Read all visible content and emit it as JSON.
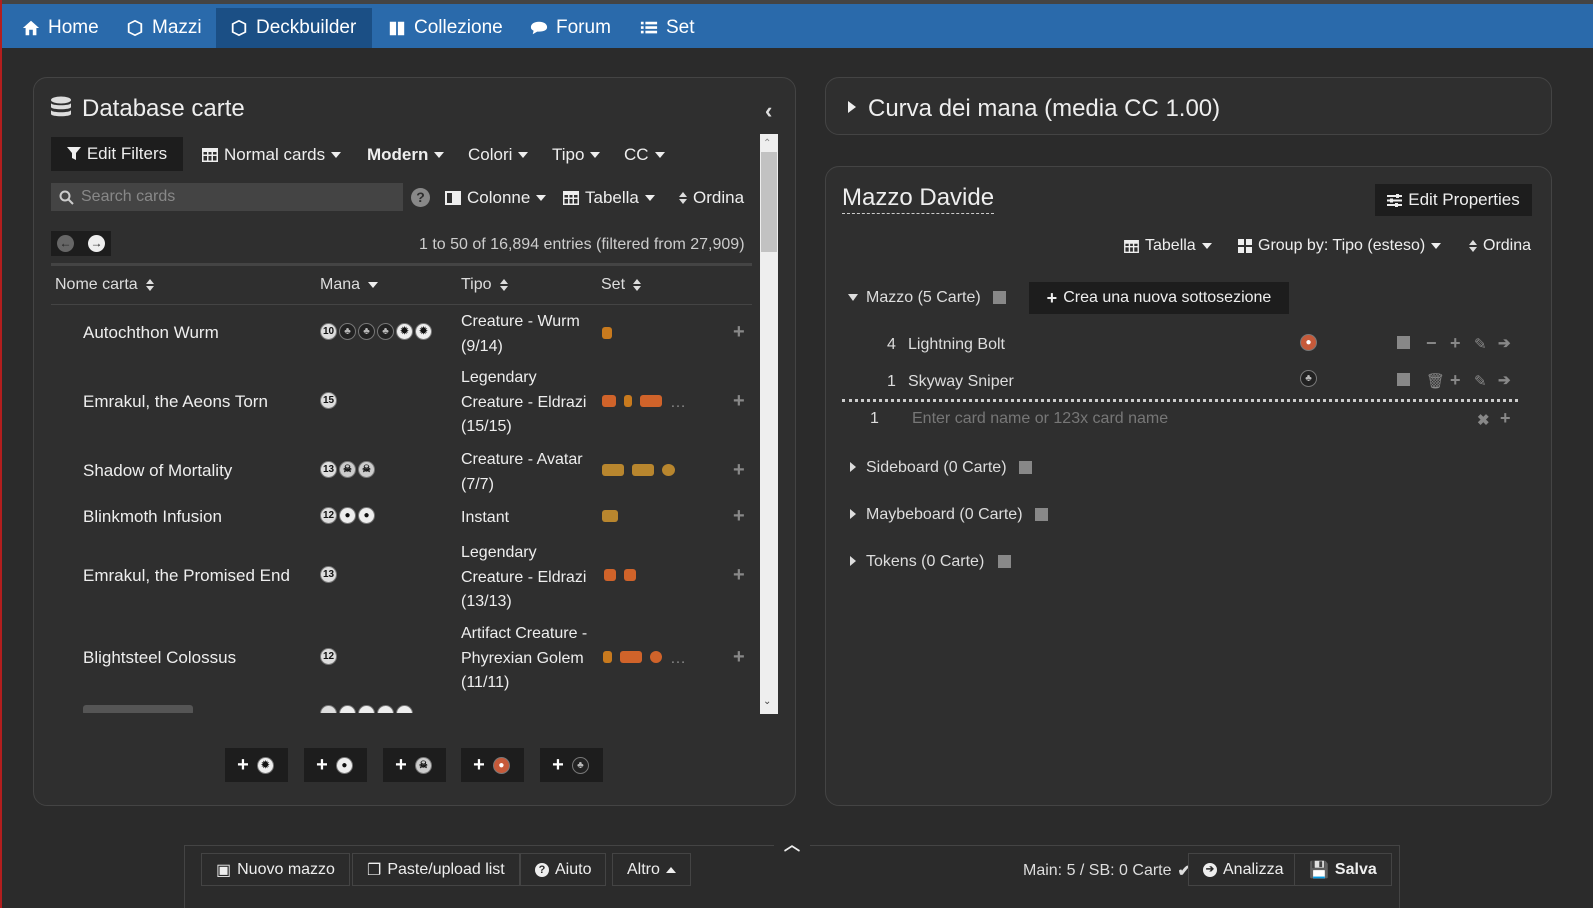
{
  "nav": {
    "items": [
      {
        "label": "Home",
        "icon": "home-icon"
      },
      {
        "label": "Mazzi",
        "icon": "box-icon"
      },
      {
        "label": "Deckbuilder",
        "icon": "box-edit-icon"
      },
      {
        "label": "Collezione",
        "icon": "book-icon"
      },
      {
        "label": "Forum",
        "icon": "comments-icon"
      },
      {
        "label": "Set",
        "icon": "list-icon"
      }
    ],
    "active": "Deckbuilder"
  },
  "db": {
    "title": "Database carte",
    "edit_filters": "Edit Filters",
    "normal_cards": "Normal cards",
    "format": "Modern",
    "colori": "Colori",
    "tipo": "Tipo",
    "cc": "CC",
    "search_placeholder": "Search cards",
    "help": "?",
    "colonne": "Colonne",
    "tabella": "Tabella",
    "ordina": "Ordina",
    "entries": "1 to 50 of 16,894 entries (filtered from 27,909)",
    "columns": [
      "Nome carta",
      "Mana",
      "Tipo",
      "Set"
    ],
    "rows": [
      {
        "name": "Autochthon Wurm",
        "mana": [
          "10",
          "G",
          "G",
          "G",
          "W",
          "W"
        ],
        "type": [
          "Creature - Wurm",
          "(9/14)"
        ]
      },
      {
        "name": "Emrakul, the Aeons Torn",
        "mana": [
          "15"
        ],
        "type": [
          "Legendary",
          "Creature - Eldrazi",
          "(15/15)"
        ]
      },
      {
        "name": "Shadow of Mortality",
        "mana": [
          "13",
          "B",
          "B"
        ],
        "type": [
          "Creature - Avatar",
          "(7/7)"
        ]
      },
      {
        "name": "Blinkmoth Infusion",
        "mana": [
          "12",
          "U",
          "U"
        ],
        "type": [
          "Instant"
        ]
      },
      {
        "name": "Emrakul, the Promised End",
        "mana": [
          "13"
        ],
        "type": [
          "Legendary",
          "Creature - Eldrazi",
          "(13/13)"
        ]
      },
      {
        "name": "Blightsteel Colossus",
        "mana": [
          "12"
        ],
        "type": [
          "Artifact Creature -",
          "Phyrexian Golem",
          "(11/11)"
        ]
      }
    ],
    "quick_add": [
      "+ W",
      "+ U",
      "+ B",
      "+ R",
      "+ G"
    ]
  },
  "curve": {
    "title": "Curva dei mana (media CC 1.00)"
  },
  "deck": {
    "title": "Mazzo Davide",
    "edit_properties": "Edit Properties",
    "tabella": "Tabella",
    "group_by": "Group by: Tipo (esteso)",
    "ordina": "Ordina",
    "section_main": "Mazzo (5 Carte)",
    "new_subsection": "Crea una nuova sottosezione",
    "cards": [
      {
        "qty": "4",
        "name": "Lightning Bolt",
        "color": "R"
      },
      {
        "qty": "1",
        "name": "Skyway Sniper",
        "color": "G"
      }
    ],
    "entry_qty": "1",
    "entry_placeholder": "Enter card name or 123x card name",
    "sections": [
      "Sideboard (0 Carte)",
      "Maybeboard (0 Carte)",
      "Tokens (0 Carte)"
    ]
  },
  "footer": {
    "nuovo_mazzo": "Nuovo mazzo",
    "paste_upload": "Paste/upload list",
    "aiuto": "Aiuto",
    "altro": "Altro",
    "status": "Main: 5 / SB: 0 Carte",
    "analizza": "Analizza",
    "salva": "Salva"
  }
}
